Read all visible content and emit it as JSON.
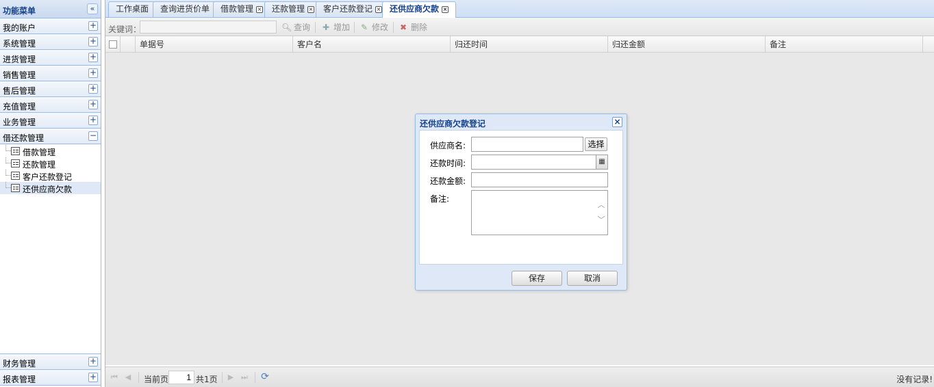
{
  "sidebar": {
    "title": "功能菜单",
    "collapse_icon": "«",
    "menu_top": [
      {
        "label": "我的账户",
        "toggle": "+"
      },
      {
        "label": "系统管理",
        "toggle": "+"
      },
      {
        "label": "进货管理",
        "toggle": "+"
      },
      {
        "label": "销售管理",
        "toggle": "+"
      },
      {
        "label": "售后管理",
        "toggle": "+"
      },
      {
        "label": "充值管理",
        "toggle": "+"
      },
      {
        "label": "业务管理",
        "toggle": "+"
      },
      {
        "label": "借还款管理",
        "toggle": "−"
      }
    ],
    "submenu": [
      {
        "label": "借款管理"
      },
      {
        "label": "还款管理"
      },
      {
        "label": "客户还款登记"
      },
      {
        "label": "还供应商欠款"
      }
    ],
    "menu_bottom": [
      {
        "label": "财务管理",
        "toggle": "+"
      },
      {
        "label": "报表管理",
        "toggle": "+"
      }
    ]
  },
  "tabs": [
    {
      "label": "工作桌面",
      "closable": false
    },
    {
      "label": "查询进货价单",
      "closable": false
    },
    {
      "label": "借款管理",
      "closable": true
    },
    {
      "label": "还款管理",
      "closable": true
    },
    {
      "label": "客户还款登记",
      "closable": true
    },
    {
      "label": "还供应商欠款",
      "closable": true,
      "active": true
    }
  ],
  "tab_close_glyph": "×",
  "toolbar": {
    "keyword_label": "关键词：",
    "search_label": "查询",
    "add_label": "增加",
    "edit_label": "修改",
    "delete_label": "删除"
  },
  "grid": {
    "columns": [
      "单据号",
      "客户名",
      "归还时间",
      "归还金额",
      "备注"
    ],
    "rows": []
  },
  "pager": {
    "current_page_label": "当前页",
    "current_page": "1",
    "total_pages_label": "共1页",
    "status": "没有记录!"
  },
  "dialog": {
    "title": "还供应商欠款登记",
    "close_glyph": "×",
    "fields": {
      "supplier_label": "供应商名:",
      "supplier_value": "",
      "select_button": "选择",
      "date_label": "还款时间:",
      "date_value": "",
      "amount_label": "还款金额:",
      "amount_value": "",
      "remark_label": "备注:",
      "remark_value": ""
    },
    "save_button": "保存",
    "cancel_button": "取消"
  }
}
